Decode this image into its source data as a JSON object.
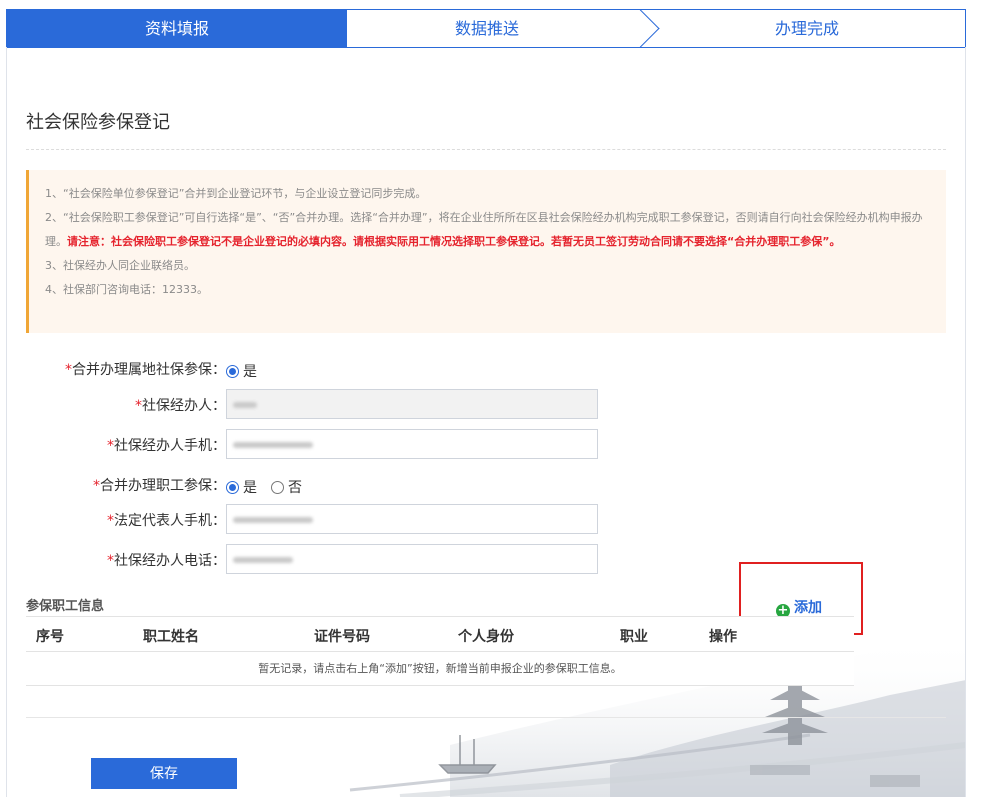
{
  "steps": [
    "资料填报",
    "数据推送",
    "办理完成"
  ],
  "page_title": "社会保险参保登记",
  "notice": {
    "line1": "1、“社会保险单位参保登记”合并到企业登记环节，与企业设立登记同步完成。",
    "line2_normal": "2、“社会保险职工参保登记”可自行选择“是”、“否”合并办理。选择“合并办理”，将在企业住所所在区县社会保险经办机构完成职工参保登记，否则请自行向社会保险经办机构申报办理。",
    "line2_red": "请注意：社会保险职工参保登记不是企业登记的必填内容。请根据实际用工情况选择职工参保登记。若暂无员工签订劳动合同请不要选择“合并办理职工参保”。",
    "line3": "3、社保经办人同企业联络员。",
    "line4": "4、社保部门咨询电话：12333。"
  },
  "form": {
    "required_mark": "*",
    "merge_local_label": "合并办理属地社保参保：",
    "merge_local_option": "是",
    "agent_label": "社保经办人：",
    "agent_phone_label": "社保经办人手机：",
    "merge_staff_label": "合并办理职工参保：",
    "merge_staff_yes": "是",
    "merge_staff_no": "否",
    "legal_phone_label": "法定代表人手机：",
    "agent_tel_label": "社保经办人电话："
  },
  "section_title": "参保职工信息",
  "add_label": "添加",
  "table": {
    "headers": [
      "序号",
      "职工姓名",
      "证件号码",
      "个人身份",
      "职业",
      "操作"
    ],
    "empty_text": "暂无记录，请点击右上角“添加”按钮，新增当前申报企业的参保职工信息。"
  },
  "save_label": "保存",
  "colors": {
    "primary": "#2a6ad9",
    "warning_bar": "#f0a636",
    "danger": "#e5232d",
    "add_icon": "#27a640"
  }
}
